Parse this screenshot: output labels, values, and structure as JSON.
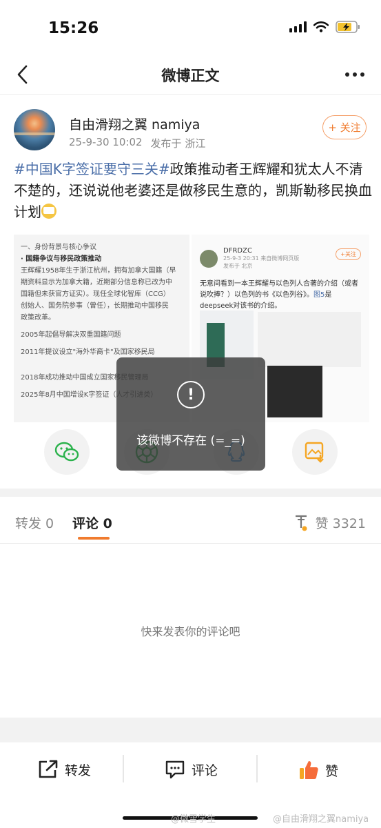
{
  "status_bar": {
    "time": "15:26"
  },
  "nav": {
    "title": "微博正文"
  },
  "post": {
    "author": "自由滑翔之翼 namiya",
    "date": "25-9-30 10:02",
    "location": "发布于 浙江",
    "follow_label": "+ 关注",
    "text": {
      "tag1": "#中国K字签证要守三关#",
      "body": "政策推动者王辉耀和犹太人不清不楚的，还说说他老婆还是做移民生意的，凯斯勒移民换血计划"
    }
  },
  "embedded_image_1": {
    "lines": [
      "一、身份背景与核心争议",
      "· 国籍争议与移民政策推动",
      "王辉耀1958年生于浙江杭州，拥有加拿大国籍（早",
      "期资料显示为加拿大籍，近期部分信息称已改为中",
      "国籍但未获官方证实）。现任全球化智库（CCG）",
      "创始人、国务院参事（曾任），长期推动中国移民",
      "政策改革。",
      "2005年起倡导解决双重国籍问题",
      "2011年提议设立\"海外华裔卡\"及国家移民局",
      "2018年成功推动中国成立国家移民管理局",
      "2025年8月中国增设K字签证（人才引进类）"
    ]
  },
  "embedded_image_2": {
    "name": "DFRDZC",
    "meta": "25-9-3 20:31 来自微博网页版",
    "location": "发布于 北京",
    "follow": "+关注",
    "text": "无意间看到一本王辉耀与以色列人合著的介绍（或者说吹捧？）以色列的书《以色列谷》。",
    "link": "图5",
    "text2": "是deepseek对该书的介绍。"
  },
  "toast": {
    "icon": "!",
    "message": "该微博不存在 (=_=)"
  },
  "tabs": {
    "repost": "转发 0",
    "comment": "评论 0",
    "like_count": "赞 3321"
  },
  "empty_comment": "快来发表你的评论吧",
  "bottom_bar": {
    "repost": "转发",
    "comment": "评论",
    "like": "赞"
  },
  "watermark": {
    "left": "@微雪学生",
    "right": "@自由滑翔之翼namiya"
  },
  "colors": {
    "accent": "#f07b2e",
    "link": "#4a6ea8",
    "wechat": "#2bb24c",
    "like": "#f5a623"
  }
}
